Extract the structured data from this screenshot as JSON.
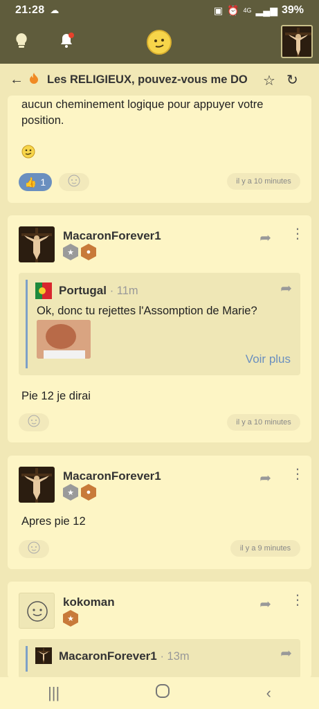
{
  "status": {
    "time": "21:28",
    "battery": "39%",
    "network": "4G"
  },
  "thread": {
    "title": "Les RELIGIEUX, pouvez-vous me DON"
  },
  "posts": [
    {
      "body_line1": "aucun cheminement logique pour appuyer votre",
      "body_line2": "position.",
      "likes": "1",
      "time": "il y a 10 minutes"
    },
    {
      "author": "MacaronForever1",
      "quote": {
        "author": "Portugal",
        "time": "· 11m",
        "text": "Ok, donc tu rejettes l'Assomption de Marie?",
        "more": "Voir plus"
      },
      "body": "Pie 12 je dirai",
      "time": "il y a 10 minutes"
    },
    {
      "author": "MacaronForever1",
      "body": "Apres pie 12",
      "time": "il y a 9 minutes"
    },
    {
      "author": "kokoman",
      "quote": {
        "author": "MacaronForever1",
        "time": "· 13m"
      }
    }
  ],
  "colors": {
    "header": "#5f5c3c",
    "background": "#f1e8b6",
    "card": "#fdf5c5",
    "like": "#6a8fbf",
    "quote_bar": "#7da0c7"
  }
}
